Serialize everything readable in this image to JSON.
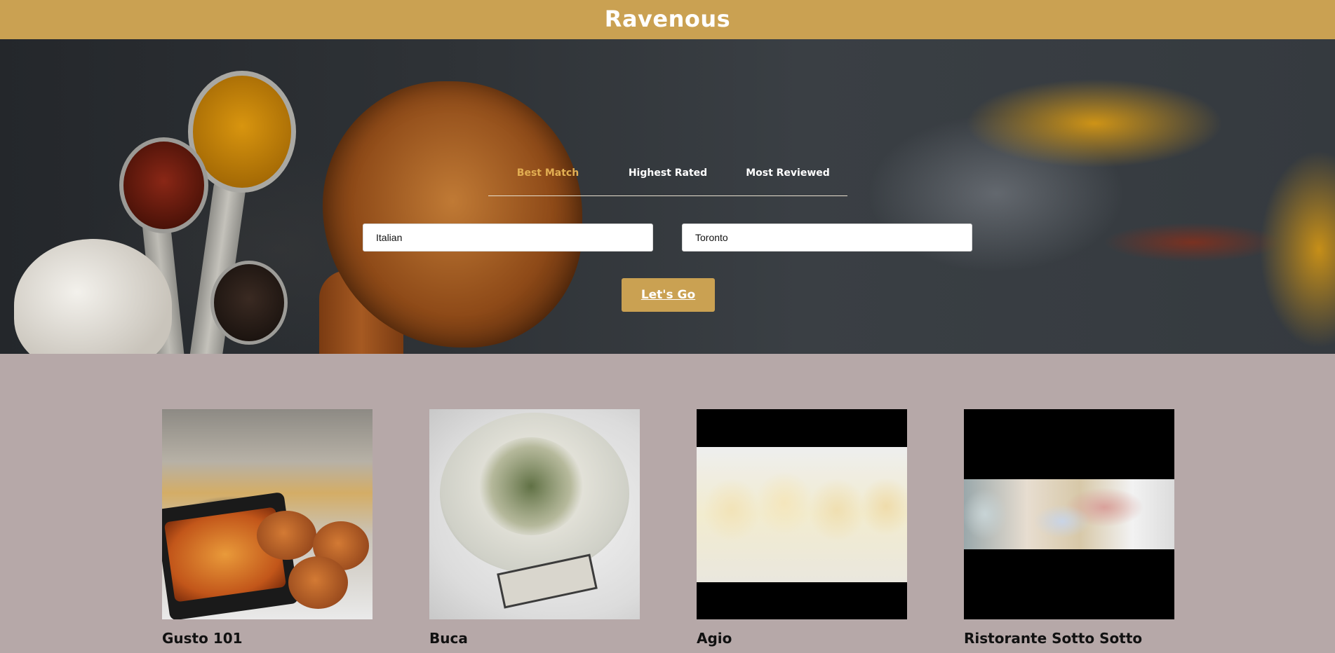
{
  "header": {
    "title": "Ravenous"
  },
  "search": {
    "sort_options": [
      {
        "label": "Best Match",
        "active": true
      },
      {
        "label": "Highest Rated",
        "active": false
      },
      {
        "label": "Most Reviewed",
        "active": false
      }
    ],
    "term_value": "Italian",
    "location_value": "Toronto",
    "submit_label": "Let's Go"
  },
  "businesses": [
    {
      "name": "Gusto 101",
      "image_icon": "lasagna-photo"
    },
    {
      "name": "Buca",
      "image_icon": "scallop-photo"
    },
    {
      "name": "Agio",
      "image_icon": "ravioli-photo"
    },
    {
      "name": "Ristorante Sotto Sotto",
      "image_icon": "charcuterie-photo"
    }
  ],
  "colors": {
    "brand": "#CAA152",
    "active_tab": "#E2AE52",
    "results_background": "#B6A8A8"
  }
}
